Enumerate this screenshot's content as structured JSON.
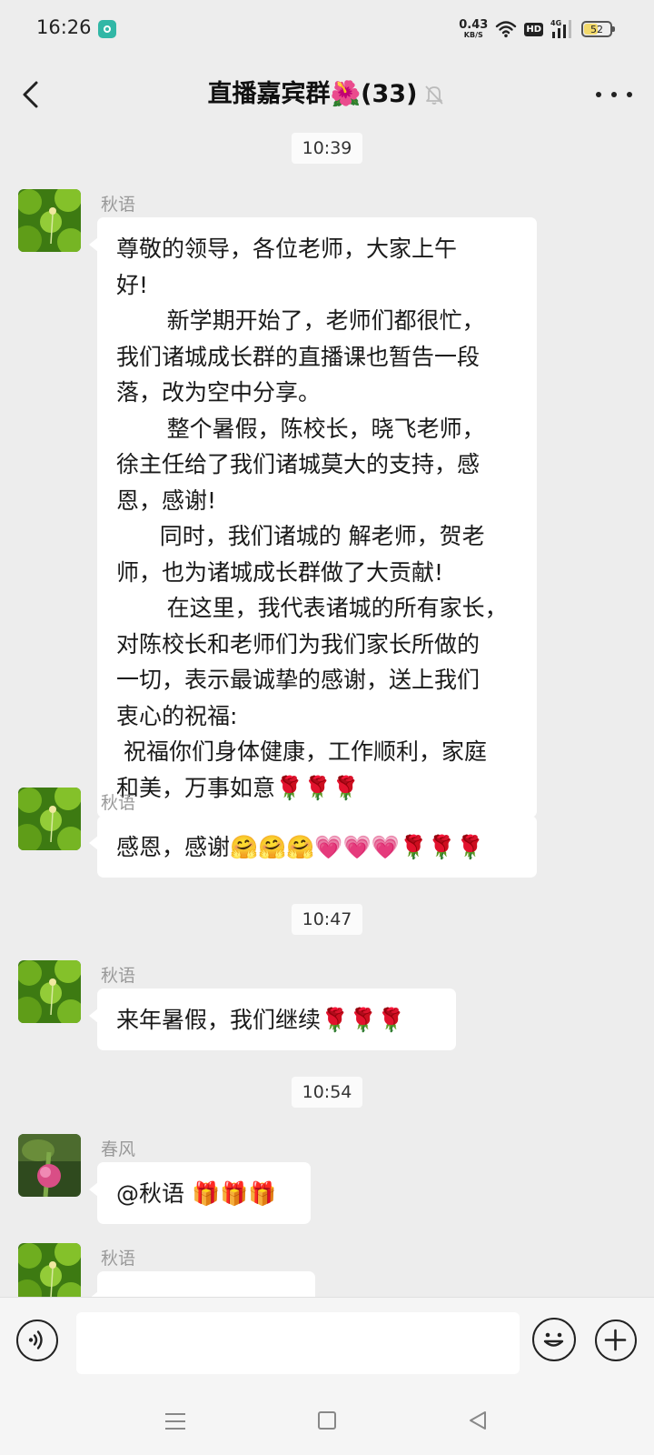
{
  "status_bar": {
    "time": "16:26",
    "net_speed_value": "0.43",
    "net_speed_unit": "KB/S",
    "hd_label": "HD",
    "network_label": "4G",
    "battery_percent": "52",
    "battery_level": 0.52,
    "icons": [
      "notification-app-icon",
      "wifi-icon",
      "hd-icon",
      "signal-icon",
      "battery-icon"
    ]
  },
  "header": {
    "title": "直播嘉宾群🌺(33)",
    "icons": [
      "back-icon",
      "mute-bell-icon",
      "more-icon"
    ]
  },
  "chat": {
    "timestamps": [
      "10:39",
      "10:47",
      "10:54"
    ],
    "messages": [
      {
        "sender": "秋语",
        "text": "尊敬的领导，各位老师，大家上午\n好!\n       新学期开始了，老师们都很忙，\n我们诸城成长群的直播课也暂告一段\n落，改为空中分享。\n       整个暑假，陈校长，晓飞老师，\n徐主任给了我们诸城莫大的支持，感\n恩，感谢!\n      同时，我们诸城的 解老师，贺老\n师，也为诸城成长群做了大贡献!\n       在这里，我代表诸城的所有家长，\n对陈校长和老师们为我们家长所做的\n一切，表示最诚挚的感谢，送上我们\n衷心的祝福:\n 祝福你们身体健康，工作顺利，家庭\n和美，万事如意🌹🌹🌹"
      },
      {
        "sender": "秋语",
        "text": "感恩，感谢🤗🤗🤗💗💗💗🌹🌹🌹"
      },
      {
        "sender": "秋语",
        "text": "来年暑假，我们继续🌹🌹🌹"
      },
      {
        "sender": "春风",
        "text": "@秋语 🎁🎁🎁"
      },
      {
        "sender": "秋语",
        "text": ""
      }
    ]
  },
  "input_bar": {
    "placeholder": "",
    "icons": [
      "voice-icon",
      "emoji-icon",
      "plus-icon"
    ]
  },
  "nav_bar": {
    "icons": [
      "menu-icon",
      "home-icon",
      "back-triangle-icon"
    ]
  },
  "colors": {
    "background": "#ededed",
    "bubble": "#ffffff",
    "sender_name": "#9a9a9a",
    "timestamp_bg": "#fbfbfb"
  }
}
